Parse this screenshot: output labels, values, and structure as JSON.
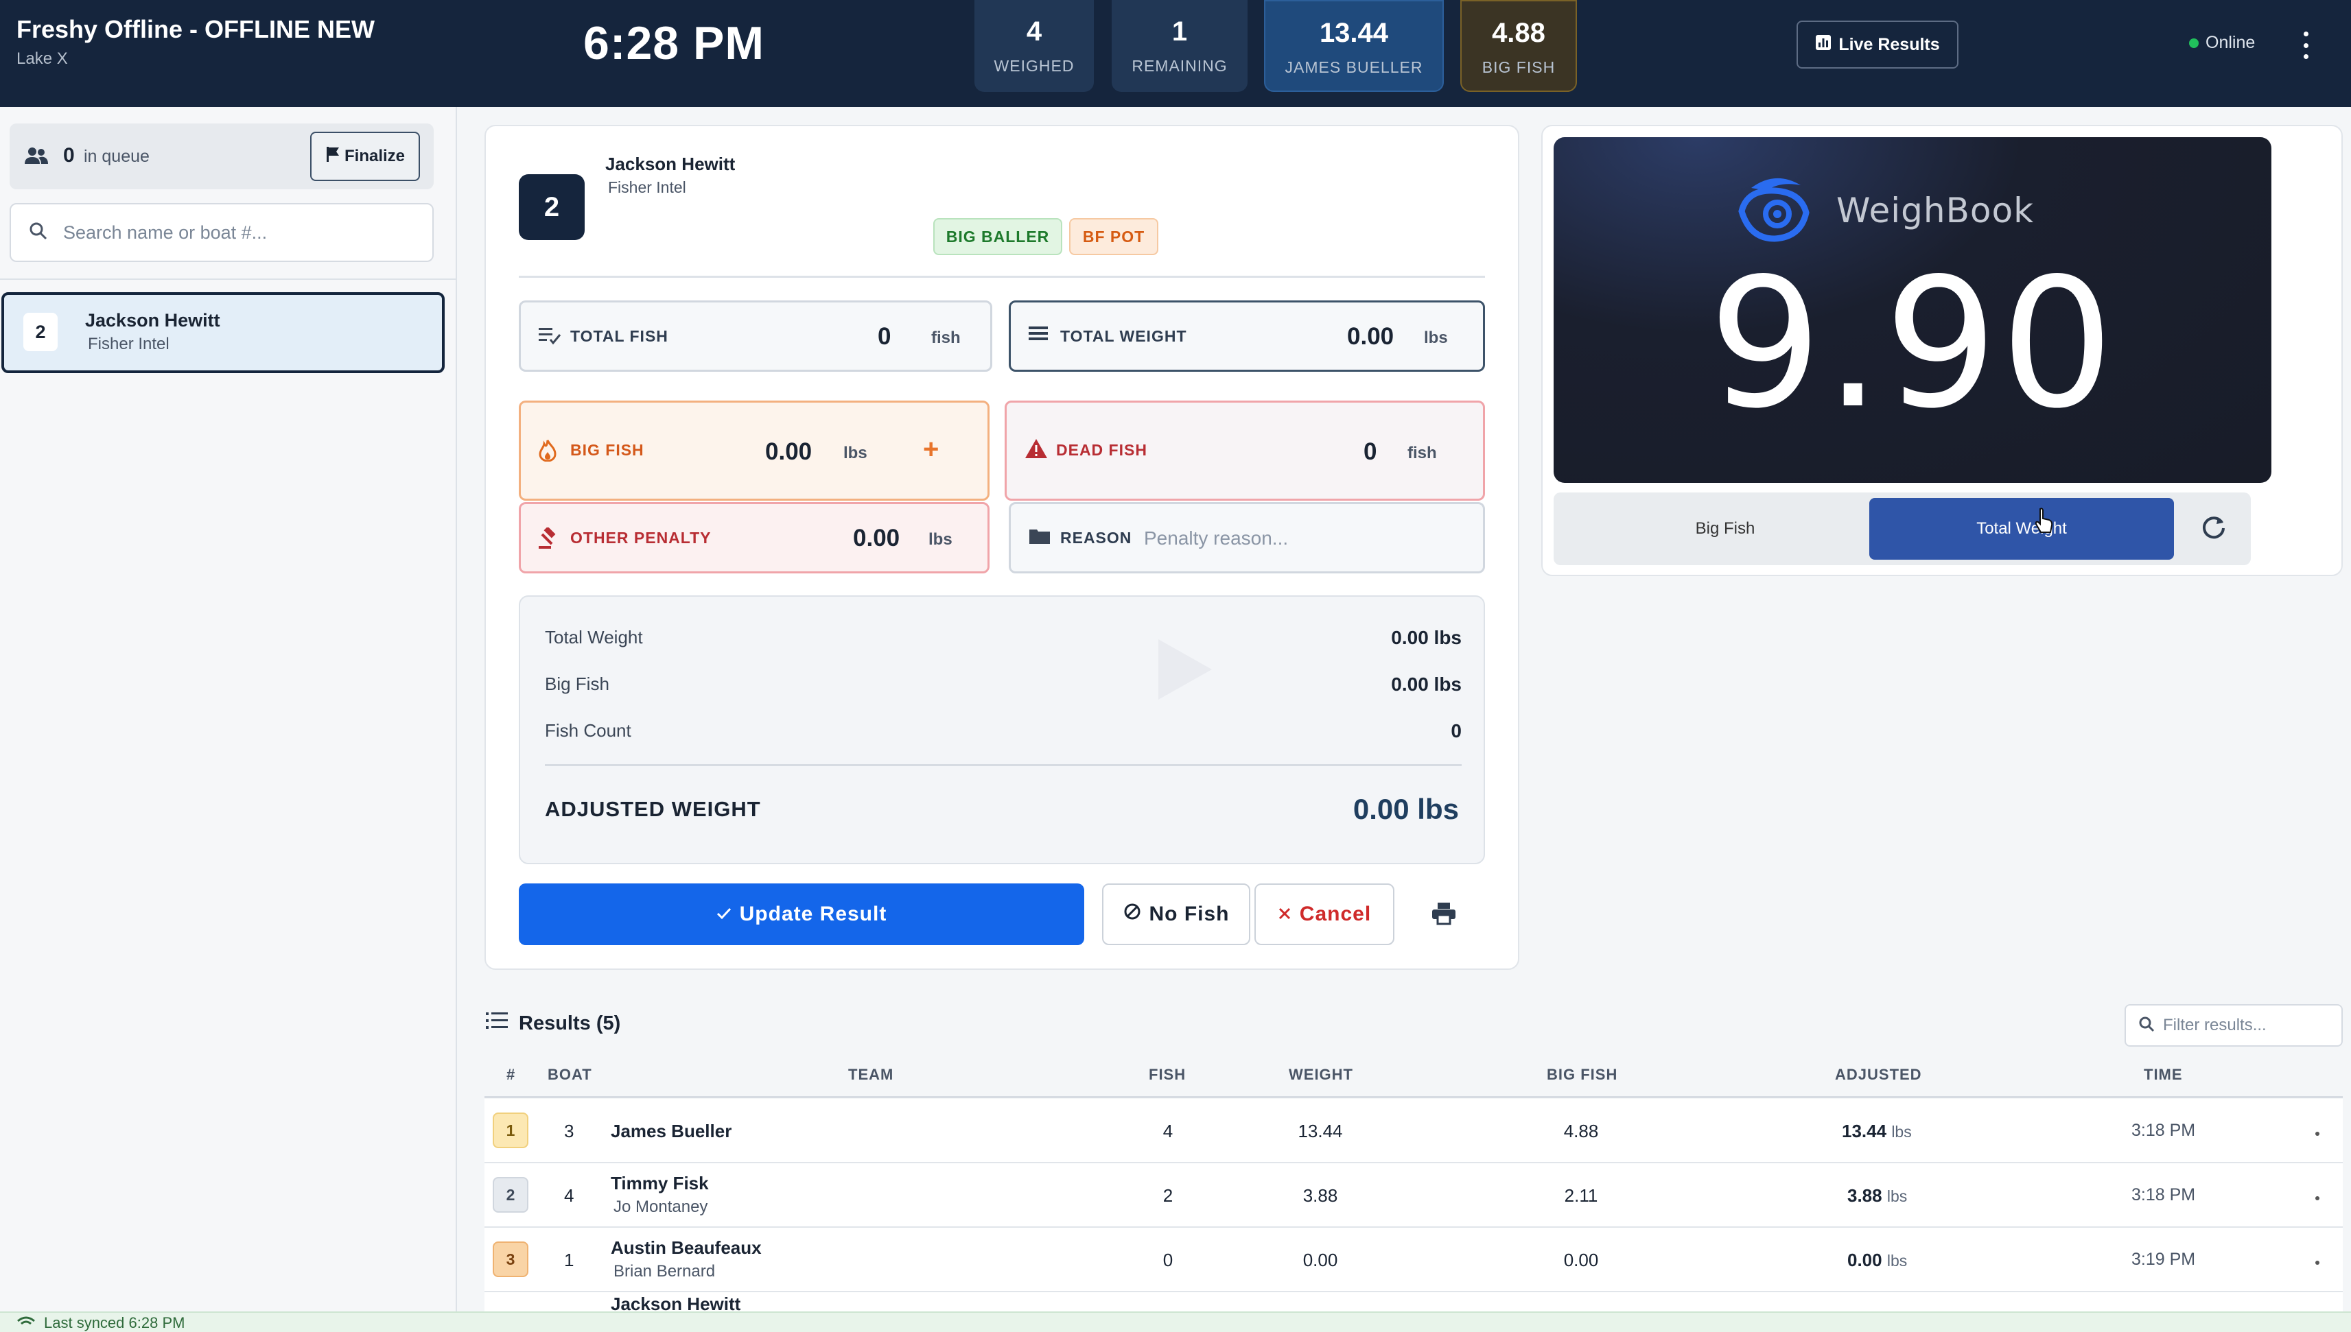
{
  "header": {
    "title": "Freshy Offline - OFFLINE NEW",
    "subtitle": "Lake X",
    "clock": "6:28 PM",
    "stats": [
      {
        "value": "4",
        "label": "WEIGHED"
      },
      {
        "value": "1",
        "label": "REMAINING"
      },
      {
        "value": "13.44",
        "label": "JAMES BUELLER"
      },
      {
        "value": "4.88",
        "label": "BIG FISH"
      }
    ],
    "live_results_label": "Live Results",
    "status": "Online",
    "colors": {
      "status_online": "#21c05c",
      "header_bg": "#15253d"
    }
  },
  "sidebar": {
    "queue_count": "0",
    "queue_label": "in queue",
    "finalize_label": "Finalize",
    "search_placeholder": "Search name or boat #...",
    "queue_items": [
      {
        "boat": "2",
        "name": "Jackson Hewitt",
        "team": "Fisher Intel"
      }
    ]
  },
  "weigh": {
    "boat": "2",
    "angler": "Jackson Hewitt",
    "team": "Fisher Intel",
    "tags": [
      "BIG BALLER",
      "BF POT"
    ],
    "fields": {
      "total_fish": {
        "label": "TOTAL FISH",
        "value": "0",
        "unit": "fish"
      },
      "total_weight": {
        "label": "TOTAL WEIGHT",
        "value": "0.00",
        "unit": "lbs"
      },
      "big_fish": {
        "label": "BIG FISH",
        "value": "0.00",
        "unit": "lbs"
      },
      "dead_fish": {
        "label": "DEAD FISH",
        "value": "0",
        "unit": "fish"
      },
      "other_penalty": {
        "label": "OTHER PENALTY",
        "value": "0.00",
        "unit": "lbs"
      },
      "reason": {
        "label": "REASON",
        "placeholder": "Penalty reason..."
      }
    },
    "summary": {
      "total_weight_label": "Total Weight",
      "total_weight_value": "0.00 lbs",
      "big_fish_label": "Big Fish",
      "big_fish_value": "0.00 lbs",
      "fish_count_label": "Fish Count",
      "fish_count_value": "0",
      "adjusted_label": "ADJUSTED WEIGHT",
      "adjusted_value": "0.00 lbs"
    },
    "buttons": {
      "update": "Update Result",
      "no_fish": "No Fish",
      "cancel": "Cancel"
    }
  },
  "scale": {
    "brand": "WeighBook",
    "reading": "9.90",
    "toggle_left": "Big Fish",
    "toggle_right": "Total Weight"
  },
  "results": {
    "title": "Results (5)",
    "filter_placeholder": "Filter results...",
    "columns": [
      "#",
      "BOAT",
      "TEAM",
      "FISH",
      "WEIGHT",
      "BIG FISH",
      "ADJUSTED",
      "TIME"
    ],
    "rows": [
      {
        "rank": "1",
        "boat": "3",
        "name": "James Bueller",
        "team": "",
        "fish": "4",
        "weight": "13.44",
        "big_fish": "4.88",
        "adjusted": "13.44",
        "unit": "lbs",
        "time": "3:18 PM"
      },
      {
        "rank": "2",
        "boat": "4",
        "name": "Timmy Fisk",
        "team": "Jo Montaney",
        "fish": "2",
        "weight": "3.88",
        "big_fish": "2.11",
        "adjusted": "3.88",
        "unit": "lbs",
        "time": "3:18 PM"
      },
      {
        "rank": "3",
        "boat": "1",
        "name": "Austin Beaufeaux",
        "team": "Brian Bernard",
        "fish": "0",
        "weight": "0.00",
        "big_fish": "0.00",
        "adjusted": "0.00",
        "unit": "lbs",
        "time": "3:19 PM"
      },
      {
        "rank": "",
        "boat": "",
        "name": "Jackson Hewitt",
        "team": "",
        "fish": "",
        "weight": "",
        "big_fish": "",
        "adjusted": "",
        "unit": "",
        "time": ""
      }
    ]
  },
  "footer": {
    "sync_text": "Last synced 6:28 PM"
  }
}
